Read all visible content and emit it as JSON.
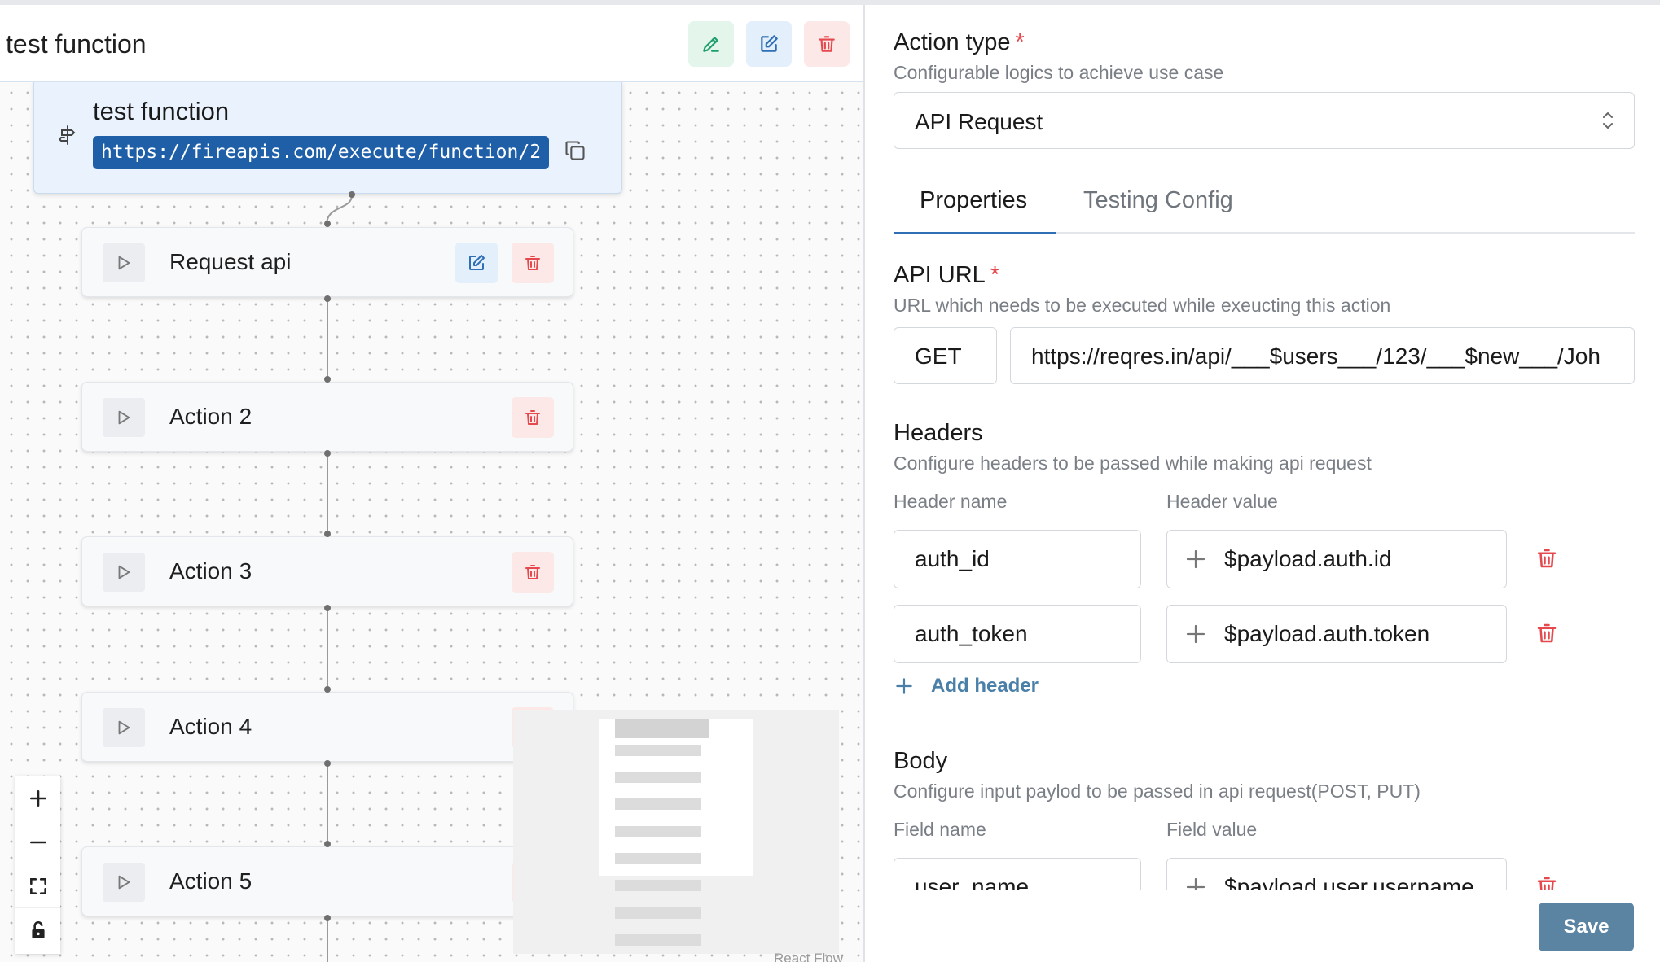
{
  "flow": {
    "title": "test function",
    "function_node": {
      "title": "test function",
      "url": "https://fireapis.com/execute/function/2"
    },
    "actions": [
      {
        "label": "Request api"
      },
      {
        "label": "Action 2"
      },
      {
        "label": "Action 3"
      },
      {
        "label": "Action 4"
      },
      {
        "label": "Action 5"
      }
    ],
    "attribution": "React Flow"
  },
  "panel": {
    "action_type": {
      "title": "Action type",
      "required_mark": "*",
      "description": "Configurable logics to achieve use case",
      "selected": "API Request"
    },
    "tabs": [
      {
        "label": "Properties",
        "active": true
      },
      {
        "label": "Testing Config",
        "active": false
      }
    ],
    "api_url": {
      "title": "API URL",
      "required_mark": "*",
      "description": "URL which needs to be executed while exeucting this action",
      "method": "GET",
      "url": "https://reqres.in/api/___$users___/123/___$new___/Joh"
    },
    "headers": {
      "title": "Headers",
      "description": "Configure headers to be passed while making api request",
      "name_label": "Header name",
      "value_label": "Header value",
      "rows": [
        {
          "name": "auth_id",
          "value": "$payload.auth.id"
        },
        {
          "name": "auth_token",
          "value": "$payload.auth.token"
        }
      ],
      "add_label": "Add header"
    },
    "body": {
      "title": "Body",
      "description": "Configure input paylod to be passed in api request(POST, PUT)",
      "name_label": "Field name",
      "value_label": "Field value",
      "rows": [
        {
          "name": "user_name",
          "value": "$payload.user.username"
        }
      ]
    },
    "save_label": "Save"
  },
  "colors": {
    "primary": "#2f6fb5",
    "url_chip": "#1f5fa8",
    "danger": "#e5484d",
    "success": "#1e9e6a",
    "save_button": "#5b84a3"
  }
}
